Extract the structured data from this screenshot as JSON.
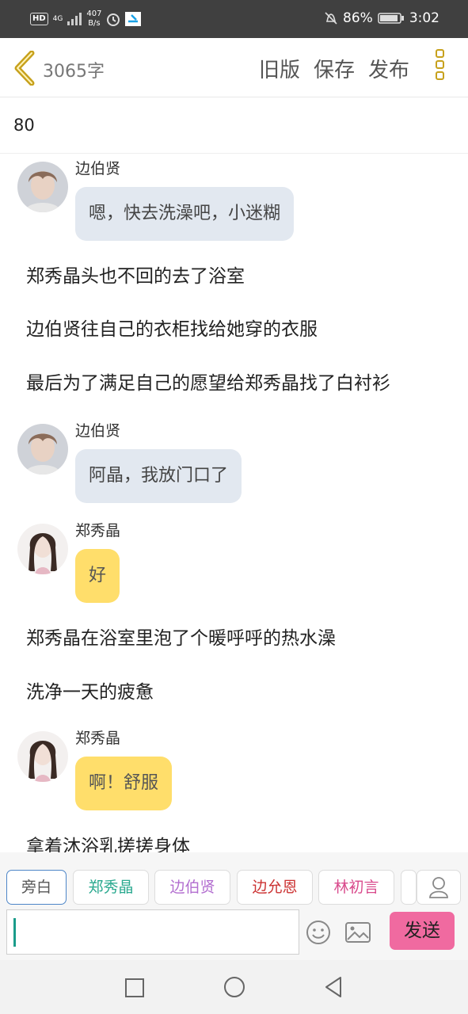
{
  "status_bar": {
    "hd": "HD",
    "network": "4G",
    "speed_value": "407",
    "speed_unit": "B/s",
    "battery": "86%",
    "time": "3:02"
  },
  "header": {
    "word_count": "3065字",
    "old_version": "旧版",
    "save": "保存",
    "publish": "发布"
  },
  "chapter_number": "80",
  "messages": [
    {
      "sender": "边伯贤",
      "text": "嗯，快去洗澡吧，小迷糊",
      "style": "blue"
    },
    {
      "narration": "郑秀晶头也不回的去了浴室"
    },
    {
      "narration": "边伯贤往自己的衣柜找给她穿的衣服"
    },
    {
      "narration": "最后为了满足自己的愿望给郑秀晶找了白衬衫"
    },
    {
      "sender": "边伯贤",
      "text": "阿晶，我放门口了",
      "style": "blue"
    },
    {
      "sender": "郑秀晶",
      "text": "好",
      "style": "yellow"
    },
    {
      "narration": "郑秀晶在浴室里泡了个暖呼呼的热水澡"
    },
    {
      "narration": "洗净一天的疲惫"
    },
    {
      "sender": "郑秀晶",
      "text": "啊！舒服",
      "style": "yellow"
    },
    {
      "narration": "拿着沐浴乳搓搓身体"
    }
  ],
  "characters": [
    {
      "label": "旁白",
      "color": "#555555"
    },
    {
      "label": "郑秀晶",
      "color": "#2aa98f"
    },
    {
      "label": "边伯贤",
      "color": "#b36fd0"
    },
    {
      "label": "边允恩",
      "color": "#cc3333"
    },
    {
      "label": "林初言",
      "color": "#d94a8c"
    }
  ],
  "composer": {
    "placeholder": "",
    "send": "发送"
  },
  "colors": {
    "accent_gold": "#c7a11c",
    "bubble_blue": "#e2e8f0",
    "bubble_yellow": "#ffde6b",
    "send_pink": "#f06aa0"
  }
}
